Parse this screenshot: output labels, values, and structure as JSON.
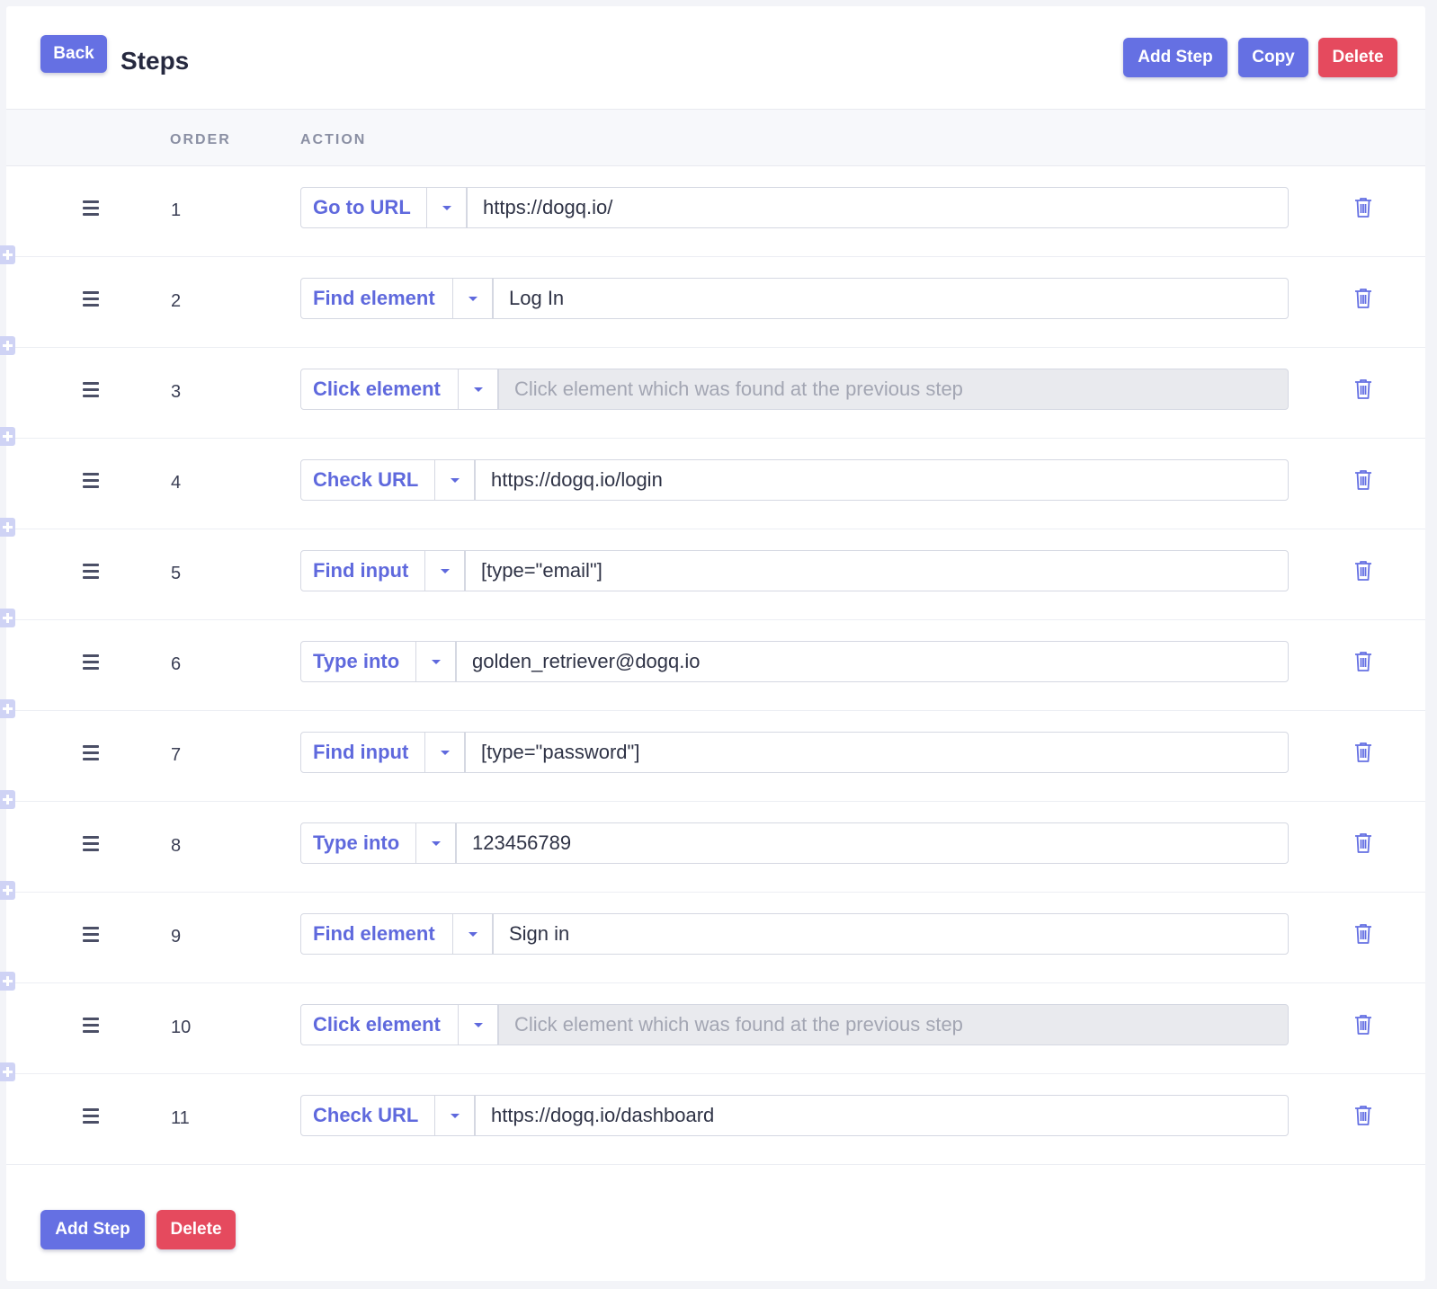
{
  "header": {
    "back_label": "Back",
    "title": "Steps",
    "add_step_label": "Add Step",
    "copy_label": "Copy",
    "delete_label": "Delete"
  },
  "table": {
    "columns": [
      "ORDER",
      "ACTION"
    ],
    "rows": [
      {
        "order": "1",
        "action": "Go to URL",
        "value": "https://dogq.io/",
        "disabled": false
      },
      {
        "order": "2",
        "action": "Find element",
        "value": "Log In",
        "disabled": false
      },
      {
        "order": "3",
        "action": "Click element",
        "value": "",
        "placeholder": "Click element which was found at the previous step",
        "disabled": true
      },
      {
        "order": "4",
        "action": "Check URL",
        "value": "https://dogq.io/login",
        "disabled": false
      },
      {
        "order": "5",
        "action": "Find input",
        "value": "[type=\"email\"]",
        "disabled": false
      },
      {
        "order": "6",
        "action": "Type into",
        "value": "golden_retriever@dogq.io",
        "disabled": false
      },
      {
        "order": "7",
        "action": "Find input",
        "value": "[type=\"password\"]",
        "disabled": false
      },
      {
        "order": "8",
        "action": "Type into",
        "value": "123456789",
        "disabled": false
      },
      {
        "order": "9",
        "action": "Find element",
        "value": "Sign in",
        "disabled": false
      },
      {
        "order": "10",
        "action": "Click element",
        "value": "",
        "placeholder": "Click element which was found at the previous step",
        "disabled": true
      },
      {
        "order": "11",
        "action": "Check URL",
        "value": "https://dogq.io/dashboard",
        "disabled": false
      }
    ]
  },
  "footer": {
    "add_step_label": "Add Step",
    "delete_label": "Delete"
  },
  "colors": {
    "primary": "#6570e3",
    "danger": "#e54a5e",
    "action_text": "#5f69dd"
  },
  "icons": {
    "drag": "drag-handle-icon",
    "caret": "caret-down-icon",
    "trash": "trash-icon",
    "insert": "plus-icon"
  }
}
